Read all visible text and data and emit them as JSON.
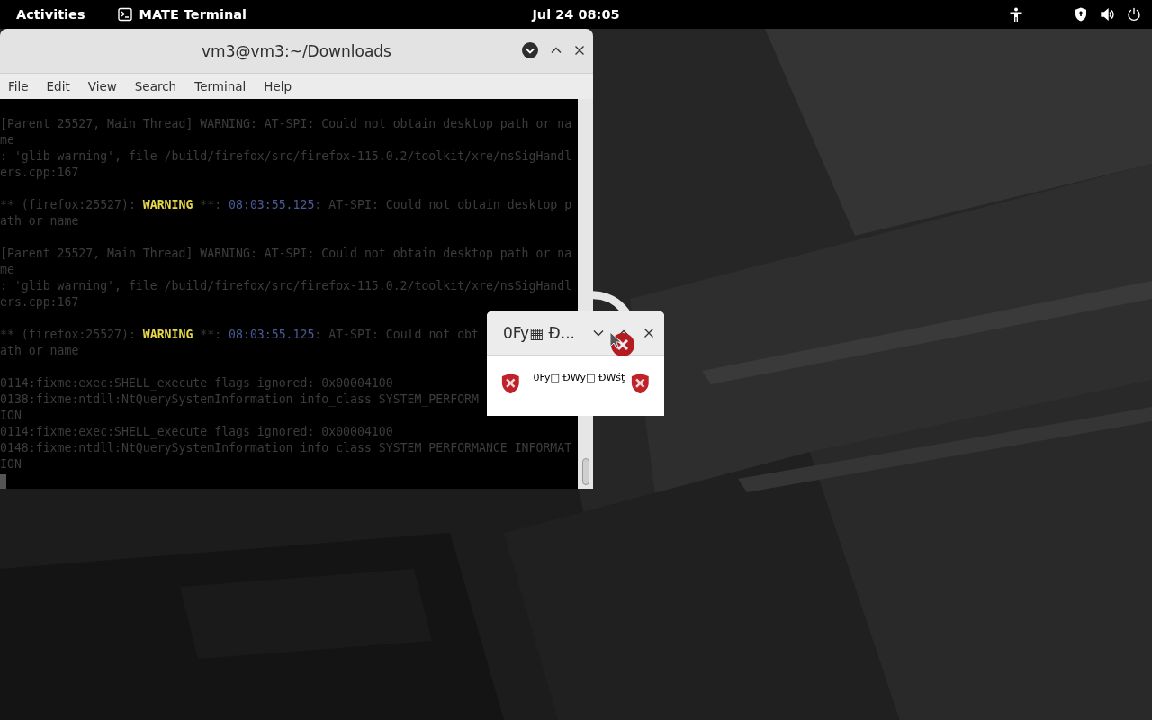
{
  "top_bar": {
    "activities": "Activities",
    "app_name": "MATE Terminal",
    "clock": "Jul 24  08:05"
  },
  "terminal": {
    "title": "vm3@vm3:~/Downloads",
    "menu": [
      "File",
      "Edit",
      "View",
      "Search",
      "Terminal",
      "Help"
    ],
    "lines": [
      {
        "kind": "text",
        "segments": [
          {
            "kind": "plain",
            "text": "[Parent 25527, Main Thread] WARNING: AT-SPI: Could not obtain desktop path or na"
          }
        ]
      },
      {
        "kind": "text",
        "segments": [
          {
            "kind": "plain",
            "text": "me"
          }
        ]
      },
      {
        "kind": "text",
        "segments": [
          {
            "kind": "plain",
            "text": ": 'glib warning', file /build/firefox/src/firefox-115.0.2/toolkit/xre/nsSigHandl"
          }
        ]
      },
      {
        "kind": "text",
        "segments": [
          {
            "kind": "plain",
            "text": "ers.cpp:167"
          }
        ]
      },
      {
        "kind": "blank"
      },
      {
        "kind": "text",
        "segments": [
          {
            "kind": "plain",
            "text": "** (firefox:25527): "
          },
          {
            "kind": "warning",
            "text": "WARNING"
          },
          {
            "kind": "plain",
            "text": " **: "
          },
          {
            "kind": "time",
            "text": "08:03:55.125"
          },
          {
            "kind": "plain",
            "text": ": AT-SPI: Could not obtain desktop p"
          }
        ]
      },
      {
        "kind": "text",
        "segments": [
          {
            "kind": "plain",
            "text": "ath or name"
          }
        ]
      },
      {
        "kind": "blank"
      },
      {
        "kind": "text",
        "segments": [
          {
            "kind": "plain",
            "text": "[Parent 25527, Main Thread] WARNING: AT-SPI: Could not obtain desktop path or na"
          }
        ]
      },
      {
        "kind": "text",
        "segments": [
          {
            "kind": "plain",
            "text": "me"
          }
        ]
      },
      {
        "kind": "text",
        "segments": [
          {
            "kind": "plain",
            "text": ": 'glib warning', file /build/firefox/src/firefox-115.0.2/toolkit/xre/nsSigHandl"
          }
        ]
      },
      {
        "kind": "text",
        "segments": [
          {
            "kind": "plain",
            "text": "ers.cpp:167"
          }
        ]
      },
      {
        "kind": "blank"
      },
      {
        "kind": "text",
        "segments": [
          {
            "kind": "plain",
            "text": "** (firefox:25527): "
          },
          {
            "kind": "warning",
            "text": "WARNING"
          },
          {
            "kind": "plain",
            "text": " **: "
          },
          {
            "kind": "time",
            "text": "08:03:55.125"
          },
          {
            "kind": "plain",
            "text": ": AT-SPI: Could not obt"
          }
        ]
      },
      {
        "kind": "text",
        "segments": [
          {
            "kind": "plain",
            "text": "ath or name"
          }
        ]
      },
      {
        "kind": "blank"
      },
      {
        "kind": "text",
        "segments": [
          {
            "kind": "plain",
            "text": "0114:fixme:exec:SHELL_execute flags ignored: 0x00004100"
          }
        ]
      },
      {
        "kind": "text",
        "segments": [
          {
            "kind": "plain",
            "text": "0138:fixme:ntdll:NtQuerySystemInformation info_class SYSTEM_PERFORM"
          }
        ]
      },
      {
        "kind": "text",
        "segments": [
          {
            "kind": "plain",
            "text": "ION"
          }
        ]
      },
      {
        "kind": "text",
        "segments": [
          {
            "kind": "plain",
            "text": "0114:fixme:exec:SHELL_execute flags ignored: 0x00004100"
          }
        ]
      },
      {
        "kind": "text",
        "segments": [
          {
            "kind": "plain",
            "text": "0148:fixme:ntdll:NtQuerySystemInformation info_class SYSTEM_PERFORMANCE_INFORMAT"
          }
        ]
      },
      {
        "kind": "text",
        "segments": [
          {
            "kind": "plain",
            "text": "ION"
          }
        ]
      }
    ]
  },
  "dialog": {
    "title": "0Fy▦ Ð...",
    "message": "0Fy□ ÐWy□ ÐWśţ"
  }
}
